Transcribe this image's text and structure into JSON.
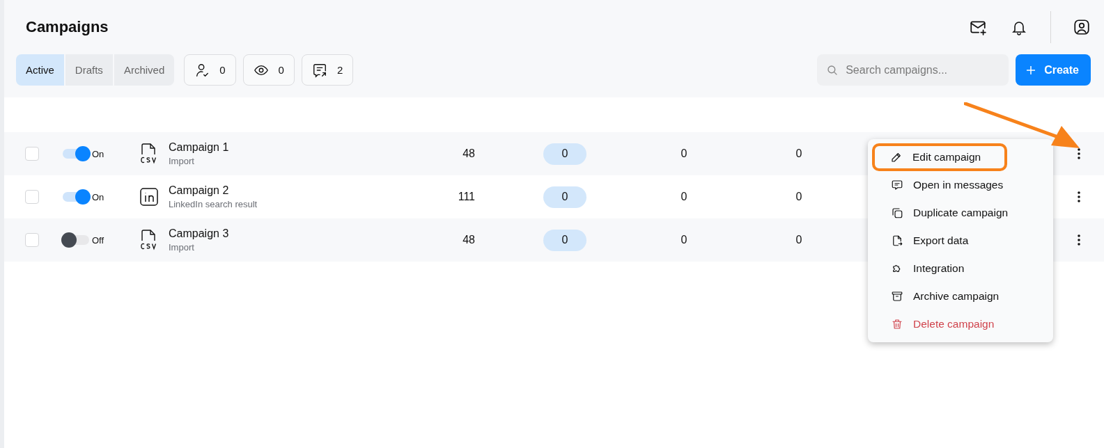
{
  "header": {
    "title": "Campaigns"
  },
  "tabs": [
    {
      "label": "Active",
      "selected": true
    },
    {
      "label": "Drafts",
      "selected": false
    },
    {
      "label": "Archived",
      "selected": false
    }
  ],
  "stats": [
    {
      "kind": "person-check",
      "value": "0"
    },
    {
      "kind": "eye",
      "value": "0"
    },
    {
      "kind": "message-out",
      "value": "2"
    }
  ],
  "search": {
    "placeholder": "Search campaigns..."
  },
  "create_button": {
    "label": "Create"
  },
  "rows": [
    {
      "checked": false,
      "on": true,
      "state_label": "On",
      "kind": "csv",
      "name": "Campaign 1",
      "subtitle": "Import",
      "column_3": "48",
      "column_4": "0",
      "column_5": "0",
      "column_6": "0"
    },
    {
      "checked": false,
      "on": true,
      "state_label": "On",
      "kind": "linkedin",
      "name": "Campaign 2",
      "subtitle": "LinkedIn search result",
      "column_3": "111",
      "column_4": "0",
      "column_5": "0",
      "column_6": "0"
    },
    {
      "checked": false,
      "on": false,
      "state_label": "Off",
      "kind": "csv",
      "name": "Campaign 3",
      "subtitle": "Import",
      "column_3": "48",
      "column_4": "0",
      "column_5": "0",
      "column_6": "0"
    }
  ],
  "context_menu": {
    "items": [
      {
        "label": "Edit campaign",
        "kind": "pencil",
        "danger": false,
        "highlighted": true
      },
      {
        "label": "Open in messages",
        "kind": "message",
        "danger": false,
        "highlighted": false
      },
      {
        "label": "Duplicate campaign",
        "kind": "copy",
        "danger": false,
        "highlighted": false
      },
      {
        "label": "Export data",
        "kind": "export",
        "danger": false,
        "highlighted": false
      },
      {
        "label": "Integration",
        "kind": "puzzle",
        "danger": false,
        "highlighted": false
      },
      {
        "label": "Archive campaign",
        "kind": "archive",
        "danger": false,
        "highlighted": false
      },
      {
        "label": "Delete campaign",
        "kind": "trash",
        "danger": true,
        "highlighted": false
      }
    ]
  }
}
